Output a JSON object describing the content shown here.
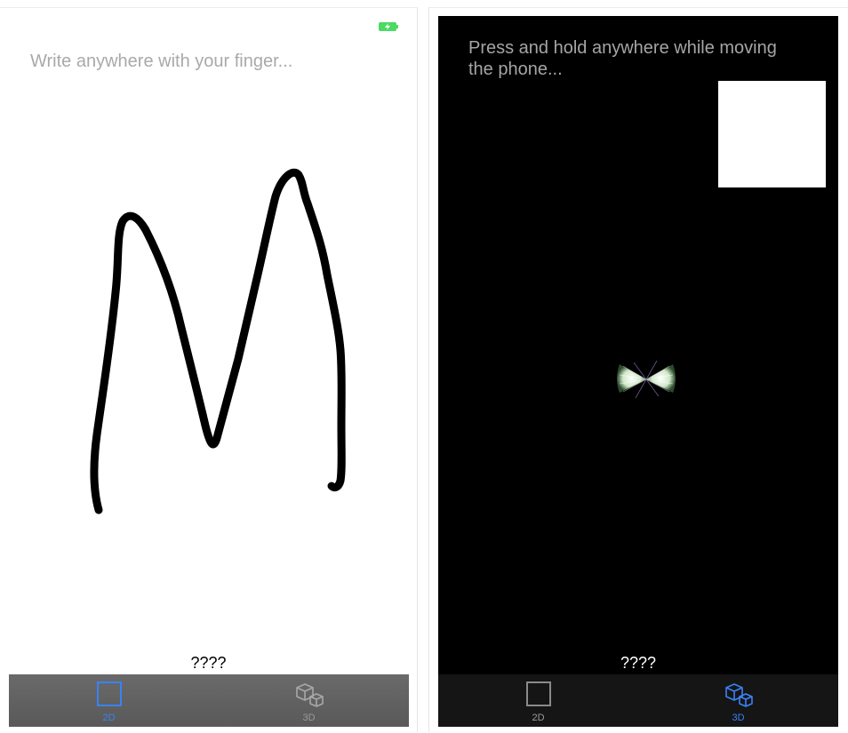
{
  "screen_2d": {
    "hint": "Write anywhere with your finger...",
    "result": "????",
    "tabs": [
      {
        "label": "2D",
        "icon": "square-icon",
        "active": true
      },
      {
        "label": "3D",
        "icon": "cubes-icon",
        "active": false
      }
    ]
  },
  "screen_3d": {
    "hint": "Press and hold anywhere while moving the phone...",
    "result": "????",
    "tabs": [
      {
        "label": "2D",
        "icon": "square-icon",
        "active": false
      },
      {
        "label": "3D",
        "icon": "cubes-icon",
        "active": true
      }
    ]
  },
  "colors": {
    "accent": "#3a82f7",
    "battery": "#4cd964",
    "inactive": "#9a9a9a"
  }
}
